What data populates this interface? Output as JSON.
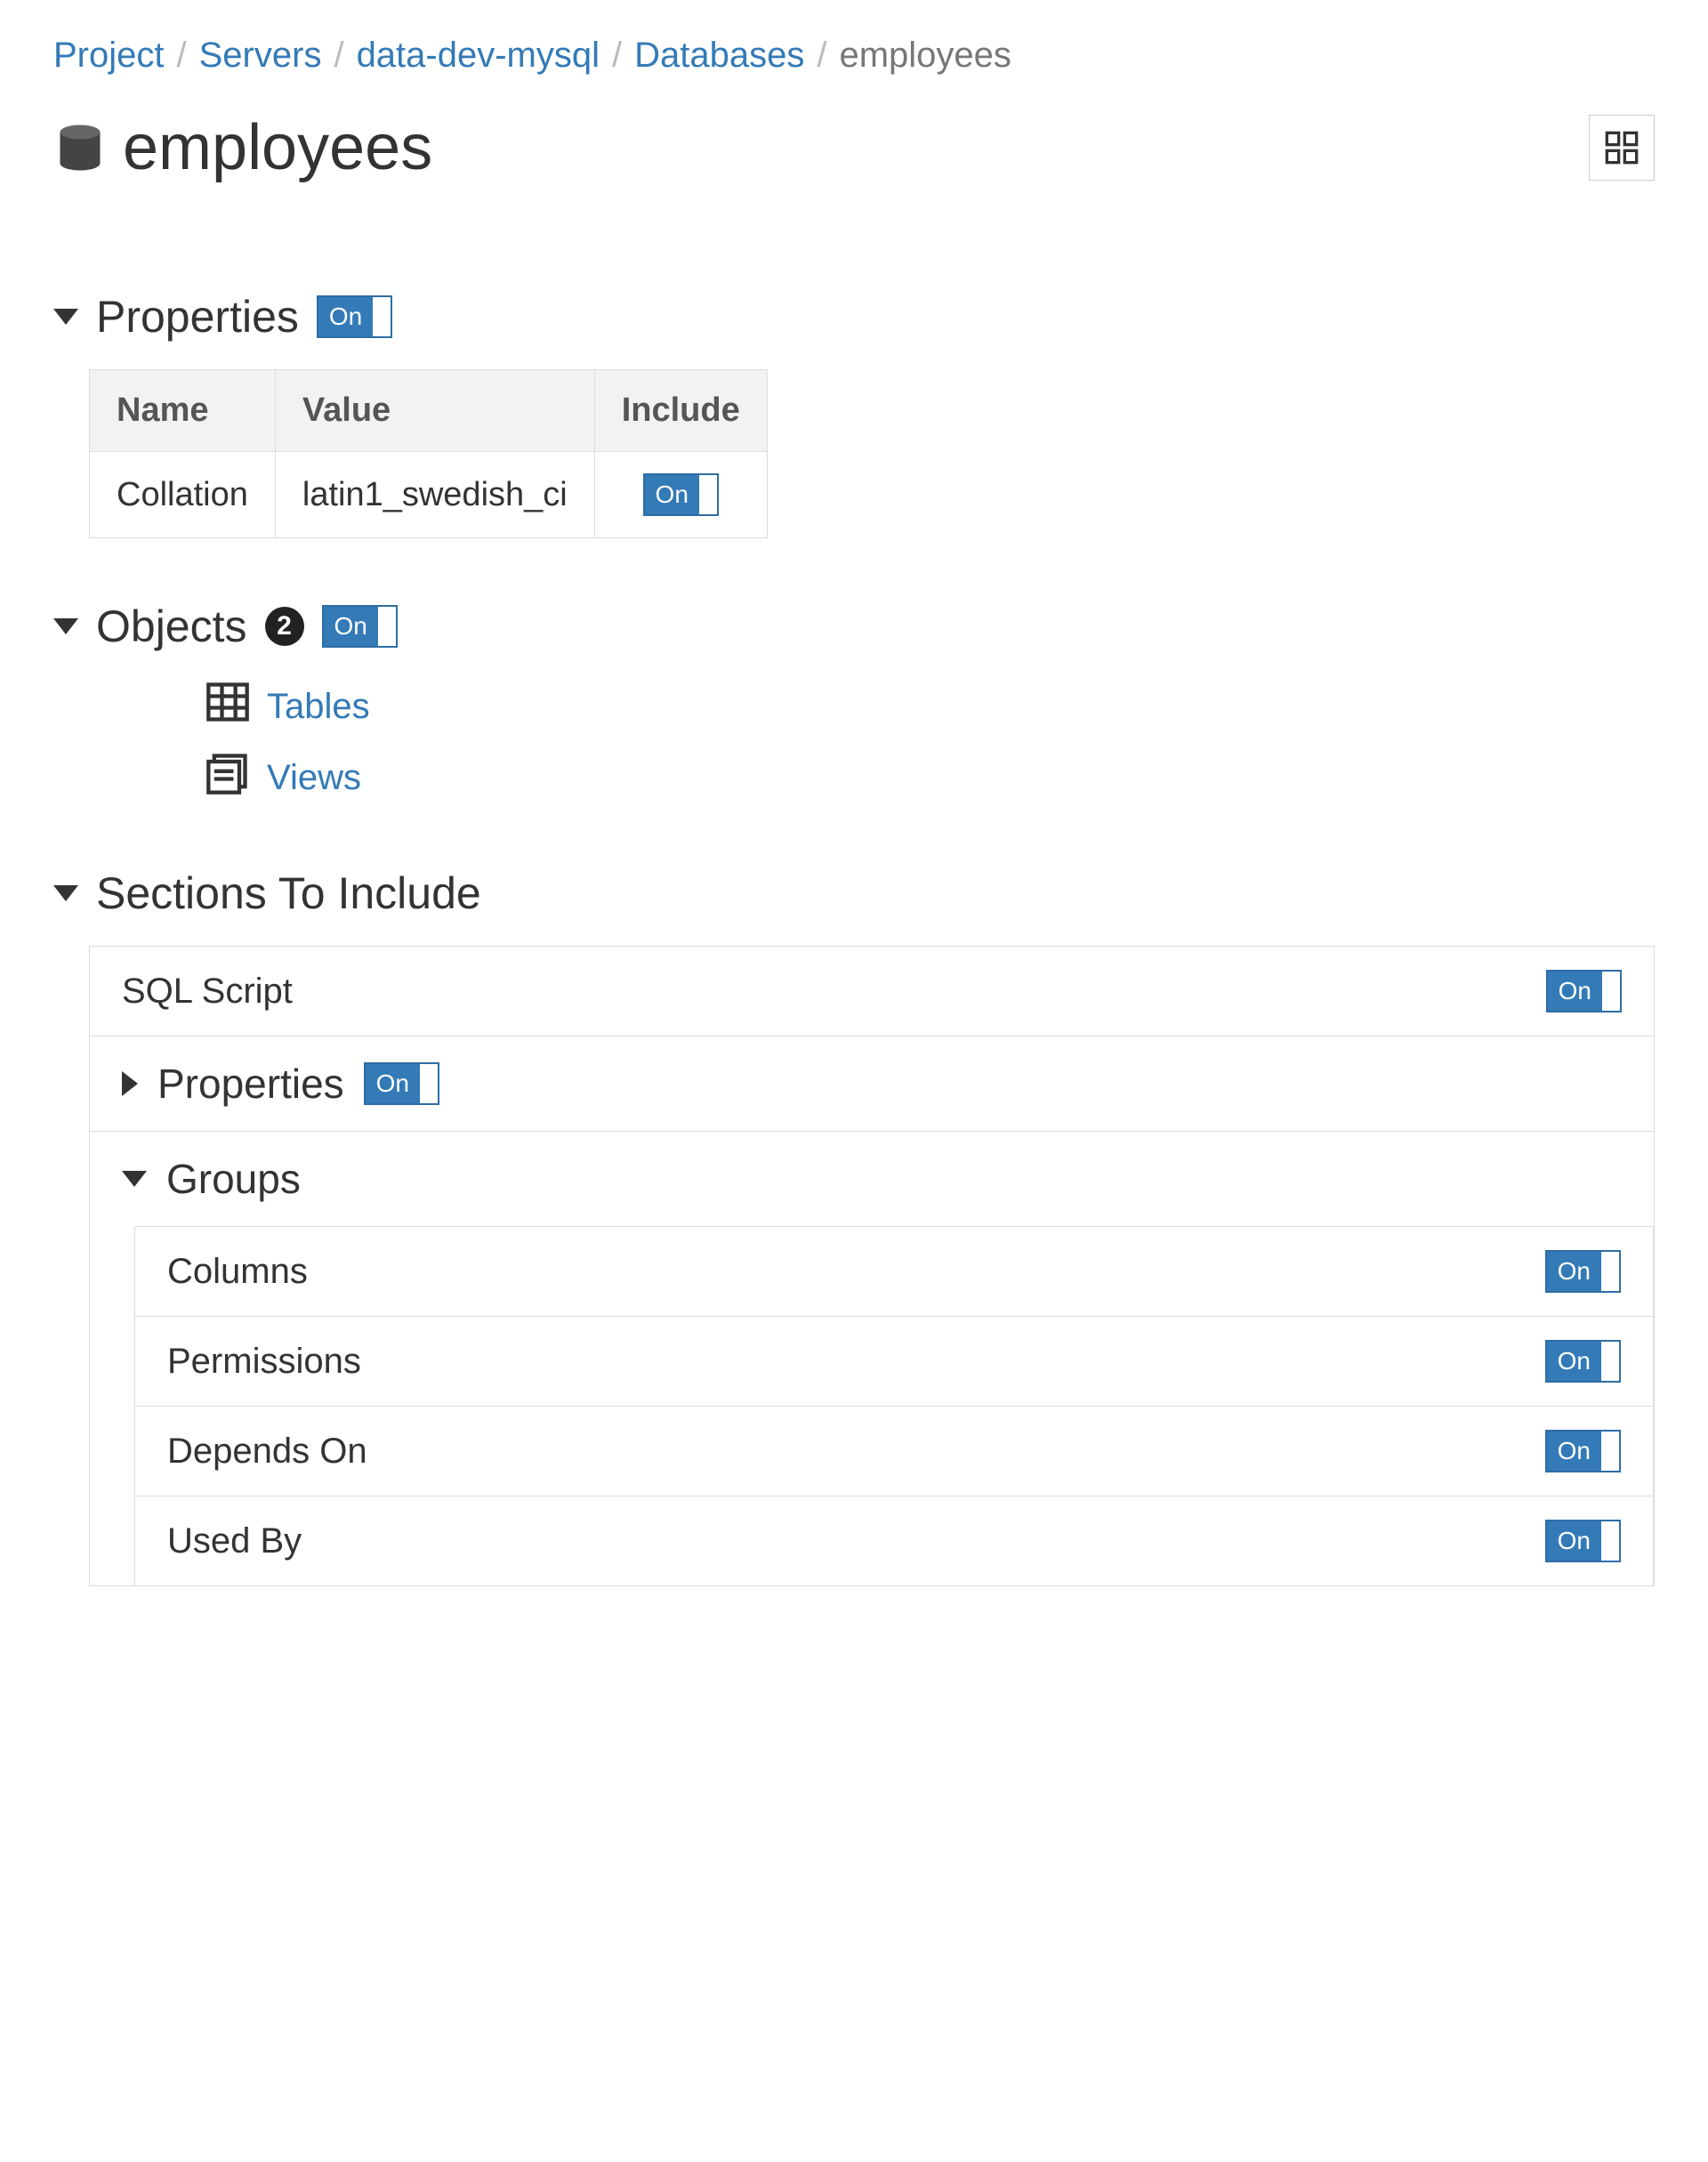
{
  "breadcrumb": {
    "project": "Project",
    "servers": "Servers",
    "server": "data-dev-mysql",
    "databases": "Databases",
    "current": "employees"
  },
  "page_title": "employees",
  "toggle_label": "On",
  "properties": {
    "heading": "Properties",
    "columns": {
      "name": "Name",
      "value": "Value",
      "include": "Include"
    },
    "rows": [
      {
        "name": "Collation",
        "value": "latin1_swedish_ci"
      }
    ]
  },
  "objects": {
    "heading": "Objects",
    "count": "2",
    "items": [
      {
        "label": "Tables"
      },
      {
        "label": "Views"
      }
    ]
  },
  "sections": {
    "heading": "Sections To Include",
    "sql_script": "SQL Script",
    "properties_sub": "Properties",
    "groups_heading": "Groups",
    "groups": [
      {
        "label": "Columns"
      },
      {
        "label": "Permissions"
      },
      {
        "label": "Depends On"
      },
      {
        "label": "Used By"
      }
    ]
  }
}
